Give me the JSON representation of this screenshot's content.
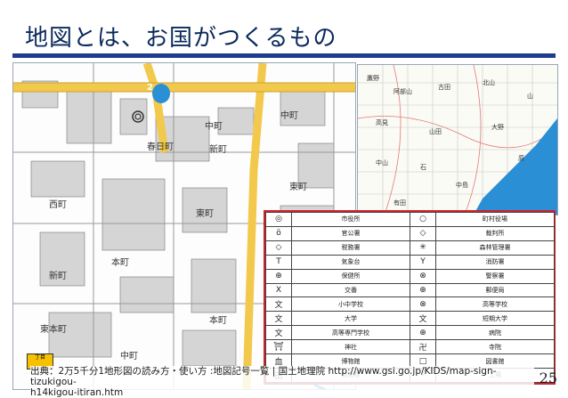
{
  "slide": {
    "title": "地図とは、お国がつくるもの",
    "page_number": "25",
    "source_line1": "出典：2万5千分1地形図の読み方・使い方 :地図記号一覧 | 国土地理院 http://www.gsi.go.jp/KIDS/map-sign-tizukigou-",
    "source_line2": "h14kigou-itiran.htm"
  },
  "main_map": {
    "labels": [
      "春日町",
      "中町",
      "新町",
      "西町",
      "東町",
      "本町",
      "中町",
      "東本町",
      "本町",
      "中町",
      "東町",
      "新町"
    ],
    "badge_number": "2",
    "corner_badge": "丁目"
  },
  "mini_map": {
    "labels": [
      "鷹野",
      "阿部山",
      "古田",
      "北山",
      "山",
      "高見",
      "山田",
      "大野",
      "中山",
      "石",
      "中島",
      "有田",
      "原"
    ]
  },
  "legend": {
    "rows": [
      {
        "left_sym": "◎",
        "left": "市役所",
        "right_sym": "○",
        "right": "町村役場"
      },
      {
        "left_sym": "ö",
        "left": "官公署",
        "right_sym": "◇",
        "right": "裁判所"
      },
      {
        "left_sym": "◇",
        "left": "税務署",
        "right_sym": "✳",
        "right": "森林管理署"
      },
      {
        "left_sym": "T",
        "left": "気象台",
        "right_sym": "Y",
        "right": "消防署"
      },
      {
        "left_sym": "⊕",
        "left": "保健所",
        "right_sym": "⊗",
        "right": "警察署"
      },
      {
        "left_sym": "X",
        "left": "交番",
        "right_sym": "⊕",
        "right": "郵便局"
      },
      {
        "left_sym": "文",
        "left": "小中学校",
        "right_sym": "⊗",
        "right": "高等学校"
      },
      {
        "left_sym": "文",
        "left": "大学",
        "right_sym": "文",
        "right": "短期大学"
      },
      {
        "left_sym": "文",
        "left": "高等専門学校",
        "right_sym": "⊕",
        "right": "病院"
      },
      {
        "left_sym": "⛩",
        "left": "神社",
        "right_sym": "卍",
        "right": "寺院"
      },
      {
        "left_sym": "血",
        "left": "博物館",
        "right_sym": "□",
        "right": "図書館"
      },
      {
        "left_sym": "田",
        "left": "自衛隊",
        "right_sym": "☼",
        "right": "工場"
      }
    ]
  },
  "colors": {
    "title_rule": "#1e3d8f",
    "main_road": "#f2c94c",
    "water": "#2a8fd4",
    "legend_border": "#d1202b"
  }
}
